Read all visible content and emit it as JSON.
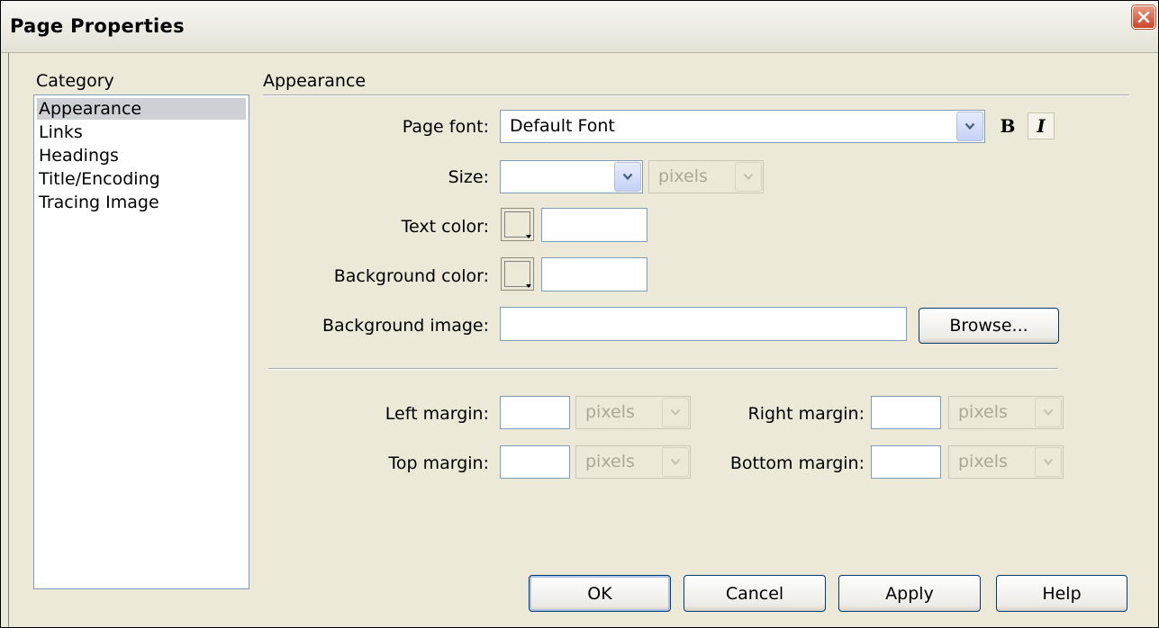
{
  "window": {
    "title": "Page Properties"
  },
  "category": {
    "heading": "Category",
    "items": [
      {
        "label": "Appearance",
        "selected": true
      },
      {
        "label": "Links",
        "selected": false
      },
      {
        "label": "Headings",
        "selected": false
      },
      {
        "label": "Title/Encoding",
        "selected": false
      },
      {
        "label": "Tracing Image",
        "selected": false
      }
    ]
  },
  "appearance": {
    "heading": "Appearance",
    "page_font_label": "Page font:",
    "page_font_value": "Default Font",
    "bold_label": "B",
    "italic_label": "I",
    "size_label": "Size:",
    "size_value": "",
    "size_unit": "pixels",
    "text_color_label": "Text color:",
    "text_color_value": "",
    "bg_color_label": "Background color:",
    "bg_color_value": "",
    "bg_image_label": "Background image:",
    "bg_image_value": "",
    "browse_label": "Browse..."
  },
  "margins": {
    "left_label": "Left margin:",
    "left_value": "",
    "left_unit": "pixels",
    "right_label": "Right margin:",
    "right_value": "",
    "right_unit": "pixels",
    "top_label": "Top margin:",
    "top_value": "",
    "top_unit": "pixels",
    "bottom_label": "Bottom margin:",
    "bottom_value": "",
    "bottom_unit": "pixels"
  },
  "buttons": {
    "ok": "OK",
    "cancel": "Cancel",
    "apply": "Apply",
    "help": "Help"
  },
  "colors": {
    "dialog_bg": "#ece9d8",
    "close_button": "#c8482a",
    "selection": "#cfcfd6"
  }
}
